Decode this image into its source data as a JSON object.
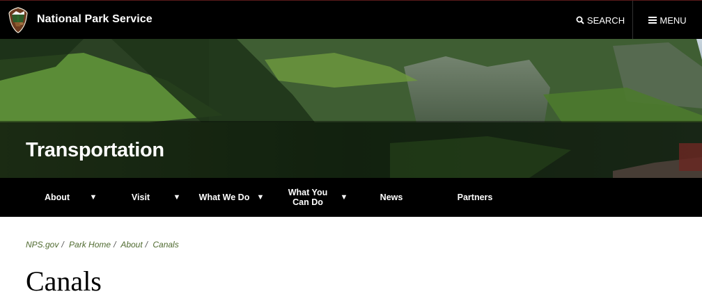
{
  "header": {
    "brand_name": "National Park Service",
    "search_label": "SEARCH",
    "menu_label": "MENU",
    "search_icon": "search-icon",
    "menu_icon": "hamburger-icon",
    "logo": "nps-arrowhead-logo"
  },
  "hero": {
    "title": "Transportation",
    "image": "mountain-valley-landscape"
  },
  "nav": {
    "items": [
      {
        "label": "About",
        "has_dropdown": true
      },
      {
        "label": "Visit",
        "has_dropdown": true
      },
      {
        "label": "What We Do",
        "has_dropdown": true
      },
      {
        "label": "What You Can Do",
        "has_dropdown": true
      },
      {
        "label": "News",
        "has_dropdown": false
      },
      {
        "label": "Partners",
        "has_dropdown": false
      }
    ],
    "caret_glyph": "▼"
  },
  "breadcrumb": {
    "items": [
      "NPS.gov",
      "Park Home",
      "About",
      "Canals"
    ],
    "separator": "/"
  },
  "page": {
    "title": "Canals"
  },
  "colors": {
    "header_bg": "#000000",
    "nav_bg": "#000000",
    "breadcrumb_link": "#4f6a2f",
    "text": "#000000"
  }
}
